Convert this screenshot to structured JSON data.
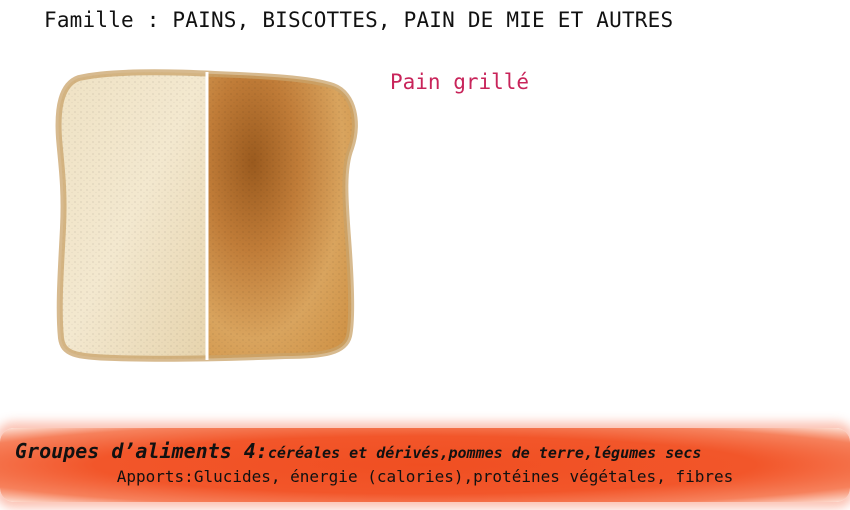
{
  "header": {
    "family_title": "Famille : PAINS, BISCOTTES, PAIN DE MIE ET AUTRES"
  },
  "product": {
    "name": "Pain grillé"
  },
  "footer": {
    "group_name": "Groupes d’aliments 4:",
    "group_items": "céréales et dérivés,pommes de terre,légumes secs",
    "intake": "Apports:Glucides, énergie (calories),protéines végétales, fibres"
  },
  "colors": {
    "product_name": "#c8245a",
    "footer_band": "#f2562a"
  },
  "image": {
    "subject": "bread-slice-half-plain-half-toasted"
  }
}
